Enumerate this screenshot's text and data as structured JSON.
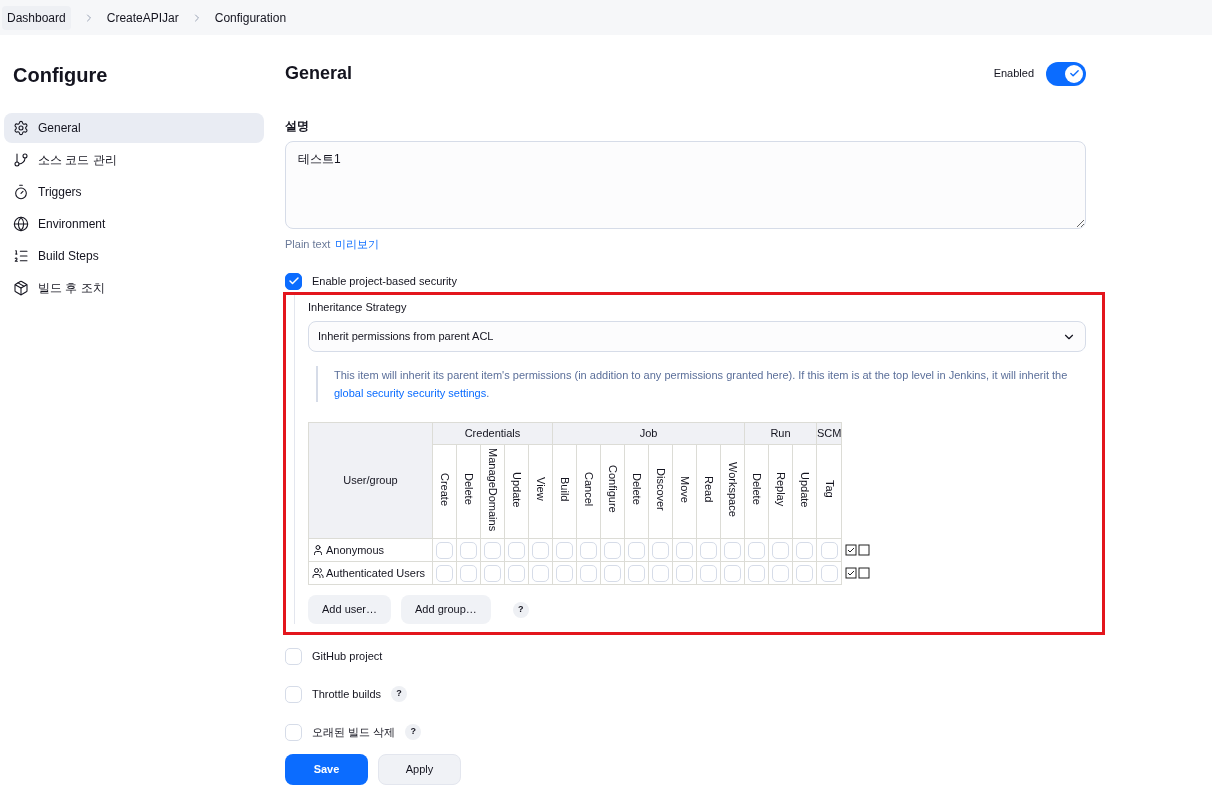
{
  "breadcrumbs": [
    {
      "label": "Dashboard"
    },
    {
      "label": "CreateAPIJar"
    },
    {
      "label": "Configuration"
    }
  ],
  "sidebar": {
    "title": "Configure",
    "items": [
      {
        "label": "General",
        "selected": true
      },
      {
        "label": "소스 코드 관리",
        "selected": false
      },
      {
        "label": "Triggers",
        "selected": false
      },
      {
        "label": "Environment",
        "selected": false
      },
      {
        "label": "Build Steps",
        "selected": false
      },
      {
        "label": "빌드 후 조치",
        "selected": false
      }
    ]
  },
  "section": {
    "title": "General",
    "enabled_label": "Enabled",
    "enabled": true
  },
  "description": {
    "label": "설명",
    "value": "테스트1",
    "format": "Plain text",
    "preview_link": "미리보기"
  },
  "project_security": {
    "label": "Enable project-based security",
    "checked": true,
    "strategy_label": "Inheritance Strategy",
    "strategy_value": "Inherit permissions from parent ACL",
    "help": "This item will inherit its parent item's permissions (in addition to any permissions granted here). If this item is at the top level in Jenkins, it will inherit the ",
    "help_link": "global security security settings",
    "help_end": ".",
    "table": {
      "user_header": "User/group",
      "groups": [
        {
          "name": "Credentials",
          "columns": [
            "Create",
            "Delete",
            "ManageDomains",
            "Update",
            "View"
          ]
        },
        {
          "name": "Job",
          "columns": [
            "Build",
            "Cancel",
            "Configure",
            "Delete",
            "Discover",
            "Move",
            "Read",
            "Workspace"
          ]
        },
        {
          "name": "Run",
          "columns": [
            "Delete",
            "Replay",
            "Update"
          ]
        },
        {
          "name": "SCM",
          "columns": [
            "Tag"
          ]
        }
      ],
      "rows": [
        {
          "name": "Anonymous",
          "kind": "user",
          "permissions": [
            false,
            false,
            false,
            false,
            false,
            false,
            false,
            false,
            false,
            false,
            false,
            false,
            false,
            false,
            false,
            false,
            false
          ]
        },
        {
          "name": "Authenticated Users",
          "kind": "group",
          "permissions": [
            false,
            false,
            false,
            false,
            false,
            false,
            false,
            false,
            false,
            false,
            false,
            false,
            false,
            false,
            false,
            false,
            false
          ]
        }
      ]
    },
    "buttons": [
      "Add user…",
      "Add group…"
    ],
    "help_mark": "?"
  },
  "options": [
    {
      "label": "GitHub project",
      "checked": false
    },
    {
      "label": "Throttle builds",
      "checked": false,
      "help": "?"
    },
    {
      "label": "오래된 빌드 삭제",
      "checked": false,
      "help": "?"
    }
  ],
  "actions": [
    "Save",
    "Apply"
  ]
}
